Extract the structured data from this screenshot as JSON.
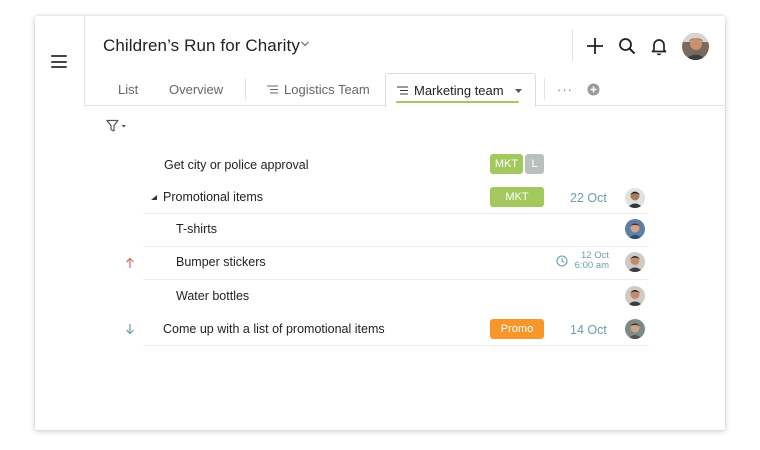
{
  "header": {
    "title": "Children’s Run for Charity",
    "actions": [
      "plus-icon",
      "search-icon",
      "bell-icon",
      "avatar"
    ]
  },
  "tabs": {
    "list": "List",
    "overview": "Overview",
    "logistics": "Logistics Team",
    "marketing": "Marketing team",
    "more": "···"
  },
  "rows": [
    {
      "label": "Get city or police approval",
      "tags": [
        "MKT",
        "L"
      ]
    },
    {
      "label": "Promotional items",
      "tags": [
        "MKT"
      ],
      "date": "22 Oct"
    },
    {
      "label": "T-shirts"
    },
    {
      "label": "Bumper stickers",
      "date_line1": "12 Oct",
      "date_line2": "6:00 am",
      "priority": "up"
    },
    {
      "label": "Water bottles"
    },
    {
      "label": "Come up with a list of promotional items",
      "tags": [
        "Promo"
      ],
      "date": "14 Oct",
      "priority": "down"
    }
  ],
  "colors": {
    "tag_mkt": "#a3c85e",
    "tag_l": "#b9c1bd",
    "tag_promo": "#f7962a",
    "date": "#6a9ea8",
    "arrow_up": "#e0655c",
    "arrow_down": "#6a9ea8",
    "tab_underline": "#a3c85e"
  }
}
